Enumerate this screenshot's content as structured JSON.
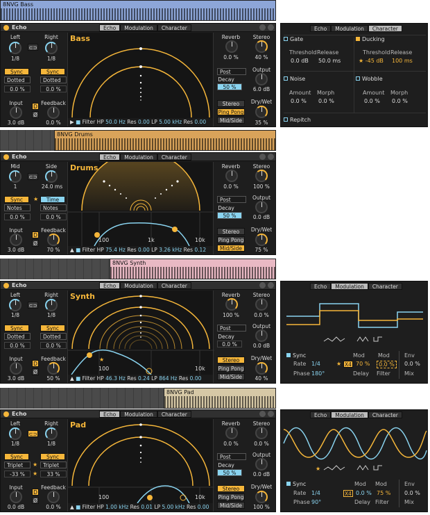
{
  "common": {
    "tab_echo": "Echo",
    "tab_mod": "Modulation",
    "tab_char": "Character",
    "dev_title": "Echo",
    "l_left": "Left",
    "l_right": "Right",
    "l_mid": "Mid",
    "l_side": "Side",
    "l_input": "Input",
    "l_feedback": "Feedback",
    "l_reverb": "Reverb",
    "l_stereo": "Stereo",
    "l_output": "Output",
    "l_decay": "Decay",
    "l_drywet": "Dry/Wet",
    "post": "Post",
    "l_sync": "Sync",
    "l_time": "Time",
    "b_d": "D",
    "b_null": "Ø",
    "b_stereo": "Stereo",
    "b_pingpong": "Ping Pong",
    "b_midside": "Mid/Side",
    "f_hp": "Filter HP",
    "f_res": "Res",
    "f_lp": "LP",
    "star": "★"
  },
  "bass": {
    "clip": "8NVG Bass",
    "name": "Bass",
    "left": "1/8",
    "right": "1/8",
    "mode_l": "Dotted",
    "mode_r": "Dotted",
    "offset_l": "0.0 %",
    "offset_r": "0.0 %",
    "input": "3.0 dB",
    "feedback": "0.0 %",
    "reverb": "0.0 %",
    "stereo": "40 %",
    "decay": "50 %",
    "output": "6.0 dB",
    "drywet": "35 %",
    "hp": "50.0 Hz",
    "res1": "0.00",
    "lp": "5.00 kHz",
    "res2": "0.00"
  },
  "drums": {
    "clip": "8NVG Drums",
    "name": "Drums",
    "left": "1",
    "right": "24.0 ms",
    "mode_l": "Notes",
    "mode_r": "Notes",
    "offset_l": "0.0 %",
    "offset_r": "0.0 %",
    "input": "3.0 dB",
    "feedback": "70 %",
    "reverb": "0.0 %",
    "stereo": "100 %",
    "decay": "50 %",
    "output": "0.0 dB",
    "drywet": "75 %",
    "hp": "75.4 Hz",
    "res1": "0.00",
    "lp": "3.26 kHz",
    "res2": "0.12",
    "tick1": "100",
    "tick2": "1k",
    "tick3": "10k"
  },
  "synth": {
    "clip": "8NVG Synth",
    "name": "Synth",
    "left": "1/8",
    "right": "1/8",
    "mode_l": "Dotted",
    "mode_r": "Dotted",
    "offset_l": "0.0 %",
    "offset_r": "0.0 %",
    "input": "3.0 dB",
    "feedback": "50 %",
    "reverb": "100 %",
    "stereo": "0.0 %",
    "decay": "0.0 %",
    "output": "0.0 dB",
    "drywet": "40 %",
    "hp": "46.3 Hz",
    "res1": "0.24",
    "lp": "864 Hz",
    "res2": "0.00",
    "tick1": "100",
    "tick3": "10k"
  },
  "pad": {
    "clip": "8NVG Pad",
    "name": "Pad",
    "left": "1/8",
    "right": "1/8",
    "mode_l": "Triplet",
    "mode_r": "Triplet",
    "offset_l": "-33 %",
    "offset_r": "33 %",
    "input": "0.0 dB",
    "feedback": "0.0 %",
    "reverb": "0.0 %",
    "stereo": "0.0 %",
    "decay": "50 %",
    "output": "0.0 dB",
    "drywet": "100 %",
    "hp": "1.00 kHz",
    "res1": "0.01",
    "lp": "5.00 kHz",
    "res2": "0.00",
    "tick1": "100",
    "tick3": "10k"
  },
  "character": {
    "gate": "Gate",
    "threshold": "Threshold",
    "release": "Release",
    "gate_thr": "0.0 dB",
    "gate_rel": "50.0 ms",
    "ducking": "Ducking",
    "duck_thr": "-45 dB",
    "duck_rel": "100 ms",
    "noise": "Noise",
    "amount": "Amount",
    "morph": "Morph",
    "noise_amt": "0.0 %",
    "noise_mor": "0.0 %",
    "wobble": "Wobble",
    "wob_amt": "0.0 %",
    "wob_mor": "0.0 %",
    "repitch": "Repitch"
  },
  "mod_synth": {
    "sync": "Sync",
    "rate": "Rate",
    "rate_v": "1/4",
    "phase": "Phase",
    "phase_v": "180°",
    "mod": "Mod",
    "x4": "X4",
    "delay_mod": "70 %",
    "filter_mod": "0.0 %",
    "delay": "Delay",
    "filter": "Filter",
    "env": "Env",
    "env_v": "0.0 %",
    "mix": "Mix"
  },
  "mod_pad": {
    "sync": "Sync",
    "rate": "Rate",
    "rate_v": "1/4",
    "phase": "Phase",
    "phase_v": "90°",
    "mod": "Mod",
    "x4": "X4",
    "delay_mod": "0.0 %",
    "filter_mod": "75 %",
    "delay": "Delay",
    "filter": "Filter",
    "env": "Env",
    "env_v": "0.0 %",
    "mix": "Mix"
  },
  "colors": {
    "accent": "#f5b63a",
    "blue": "#8ad4f0",
    "panel": "#1e1e1e"
  }
}
